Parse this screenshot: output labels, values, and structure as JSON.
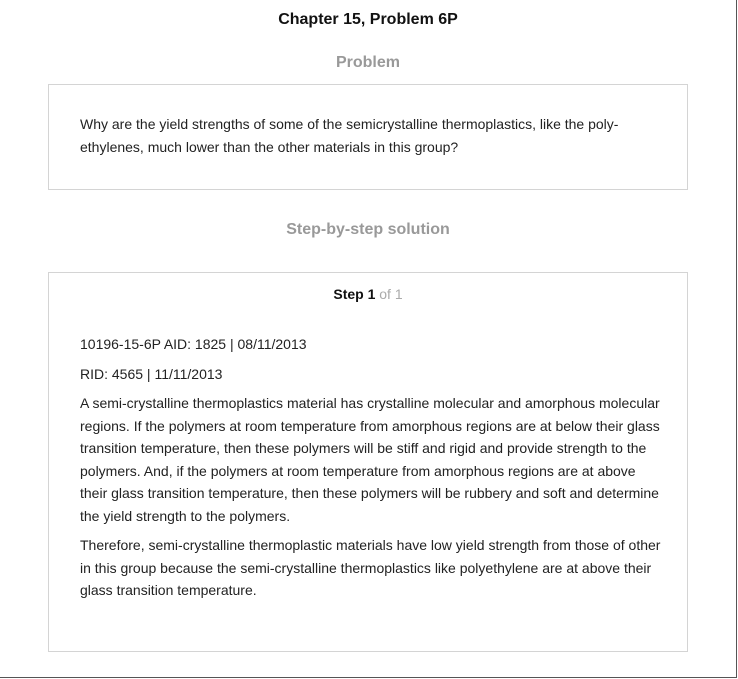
{
  "header": {
    "chapter_title": "Chapter 15, Problem 6P"
  },
  "problem": {
    "heading": "Problem",
    "text": "Why are the yield strengths of some of the semicrystalline thermoplastics, like the poly-ethylenes, much lower than the other materials in this group?"
  },
  "solution": {
    "heading": "Step-by-step solution",
    "step": {
      "word": "Step 1",
      "of_total": "of 1"
    },
    "paragraphs": [
      "10196-15-6P AID: 1825 | 08/11/2013",
      "RID: 4565 | 11/11/2013",
      "A semi-crystalline thermoplastics material has crystalline molecular and amorphous molecular regions. If the polymers at room temperature from amorphous regions are at below their glass transition temperature, then these polymers will be stiff and rigid and provide strength to the polymers. And, if the polymers at room temperature from amorphous regions are at above their glass transition temperature, then these polymers will be rubbery and soft and determine the yield strength to the polymers.",
      "Therefore, semi-crystalline thermoplastic materials have low yield strength from those of other in this group because the semi-crystalline thermoplastics like polyethylene are at above their glass transition temperature."
    ]
  }
}
